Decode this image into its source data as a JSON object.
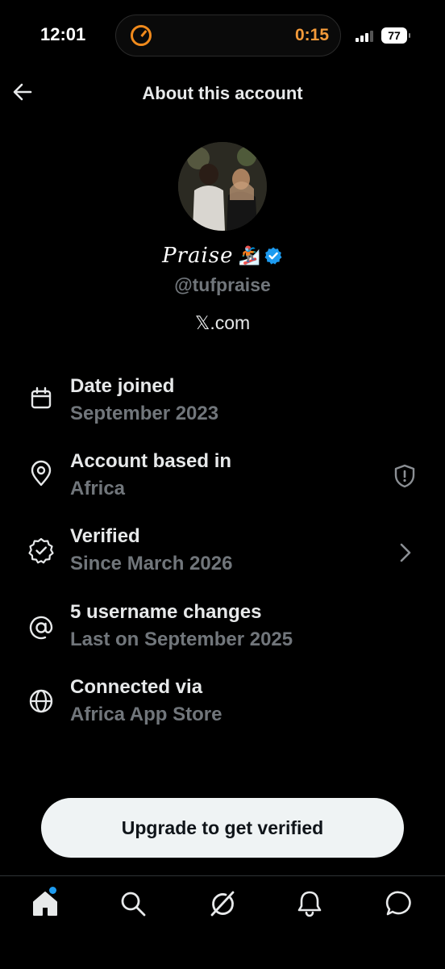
{
  "status_bar": {
    "time": "12:01",
    "timer": "0:15",
    "battery": "77"
  },
  "header": {
    "title": "About this account"
  },
  "profile": {
    "display_name": "Praise",
    "emoji": "🏂",
    "handle": "@tufpraise",
    "site": "𝕏.com"
  },
  "info_rows": [
    {
      "title": "Date joined",
      "subtitle": "September 2023",
      "icon": "calendar-icon"
    },
    {
      "title": "Account based in",
      "subtitle": "Africa",
      "icon": "location-pin-icon",
      "trailing": "shield-icon"
    },
    {
      "title": "Verified",
      "subtitle": "Since March 2026",
      "icon": "verified-check-icon",
      "trailing": "chevron-right-icon"
    },
    {
      "title": "5 username changes",
      "subtitle": "Last on September 2025",
      "icon": "at-sign-icon"
    },
    {
      "title": "Connected via",
      "subtitle": "Africa App Store",
      "icon": "globe-icon"
    }
  ],
  "upgrade_button": {
    "label": "Upgrade to get verified"
  },
  "tabs": [
    "home-icon",
    "search-icon",
    "grok-icon",
    "bell-icon",
    "message-icon"
  ],
  "colors": {
    "accent": "#1d9bf0",
    "timer": "#f39a3a",
    "muted": "#71767b"
  }
}
